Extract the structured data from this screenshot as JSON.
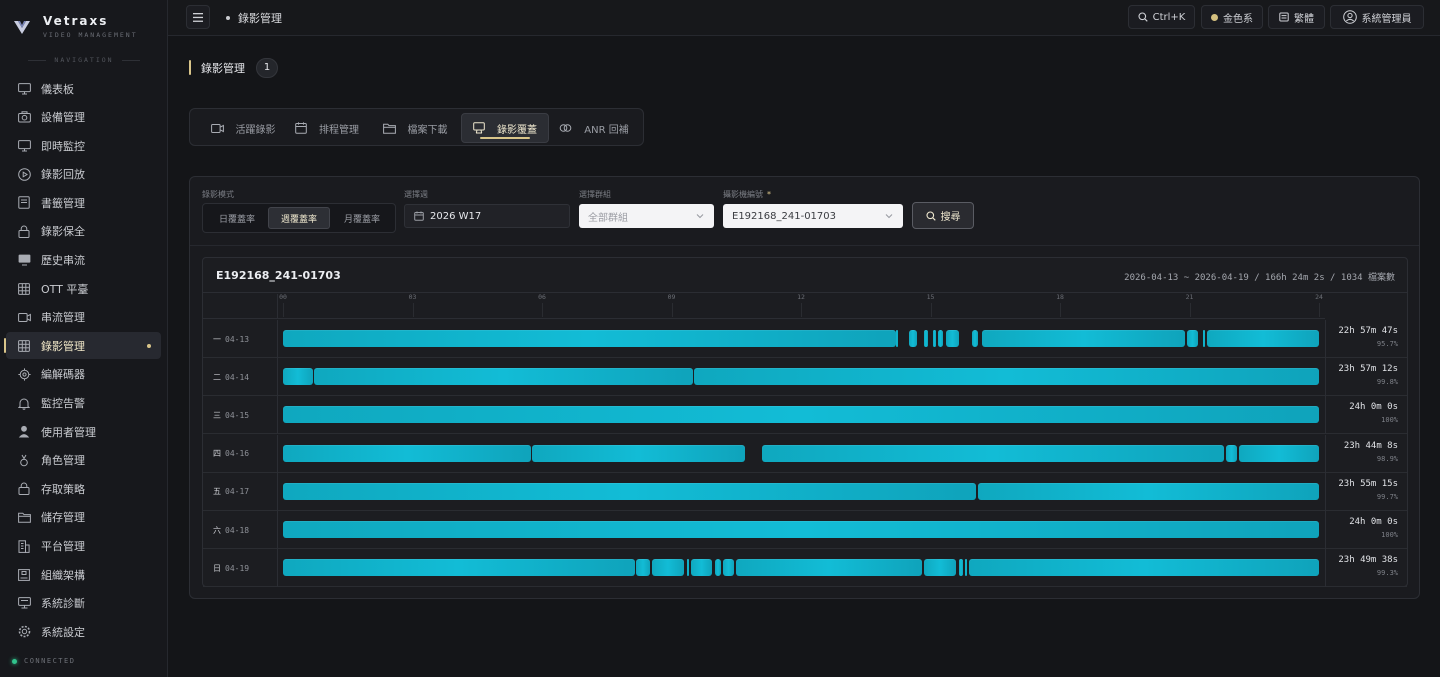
{
  "brand": {
    "name": "Vetraxs",
    "sub": "VIDEO MANAGEMENT"
  },
  "nav_heading": "NAVIGATION",
  "nav_items": [
    {
      "label": "儀表板",
      "icon": "monitor-icon"
    },
    {
      "label": "設備管理",
      "icon": "camera-icon"
    },
    {
      "label": "即時監控",
      "icon": "monitor-icon"
    },
    {
      "label": "錄影回放",
      "icon": "play-circle-icon"
    },
    {
      "label": "書籤管理",
      "icon": "bookmark-icon"
    },
    {
      "label": "錄影保全",
      "icon": "lock-icon"
    },
    {
      "label": "歷史串流",
      "icon": "screen-icon"
    },
    {
      "label": "OTT 平臺",
      "icon": "grid-icon"
    },
    {
      "label": "串流管理",
      "icon": "video-icon"
    },
    {
      "label": "錄影管理",
      "icon": "grid-icon",
      "active": true
    },
    {
      "label": "編解碼器",
      "icon": "chip-icon"
    },
    {
      "label": "監控告警",
      "icon": "bell-icon"
    },
    {
      "label": "使用者管理",
      "icon": "user-icon"
    },
    {
      "label": "角色管理",
      "icon": "role-icon"
    },
    {
      "label": "存取策略",
      "icon": "lock-icon"
    },
    {
      "label": "儲存管理",
      "icon": "folder-icon"
    },
    {
      "label": "平台管理",
      "icon": "building-icon"
    },
    {
      "label": "組織架構",
      "icon": "org-icon"
    },
    {
      "label": "系統診斷",
      "icon": "diagnose-icon"
    },
    {
      "label": "系統設定",
      "icon": "gear-icon"
    }
  ],
  "status": "CONNECTED",
  "topbar": {
    "breadcrumb": "錄影管理",
    "search_shortcut": "Ctrl+K",
    "theme": "金色系",
    "language": "繁體",
    "user": "系統管理員"
  },
  "page": {
    "title": "錄影管理",
    "count": "1"
  },
  "tabs": [
    {
      "label": "活躍錄影",
      "icon": "video-icon"
    },
    {
      "label": "排程管理",
      "icon": "calendar-icon"
    },
    {
      "label": "檔案下載",
      "icon": "folder-icon"
    },
    {
      "label": "錄影覆蓋",
      "icon": "coverage-icon",
      "active": true
    },
    {
      "label": "ANR 回補",
      "icon": "link-icon"
    }
  ],
  "filters": {
    "mode_label": "錄影模式",
    "modes": [
      "日覆蓋率",
      "週覆蓋率",
      "月覆蓋率"
    ],
    "mode_selected": "週覆蓋率",
    "week_label": "選擇週",
    "week_value": "2026 W17",
    "group_label": "選擇群組",
    "group_placeholder": "全部群組",
    "camera_label": "攝影機編號",
    "camera_required": "*",
    "camera_value": "E192168_241-01703",
    "search_label": "搜尋"
  },
  "timeline": {
    "camera": "E192168_241-01703",
    "summary": "2026-04-13 ~ 2026-04-19 / 166h 24m 2s / 1034 檔案數",
    "ticks": [
      "00",
      "03",
      "06",
      "09",
      "12",
      "15",
      "18",
      "21",
      "24"
    ],
    "rows": [
      {
        "weekday": "一",
        "date": "04-13",
        "duration": "22h 57m 47s",
        "pct": "95.7%",
        "segments": [
          [
            0,
            14.2
          ],
          [
            14.2,
            14.22
          ],
          [
            14.5,
            14.7
          ],
          [
            14.85,
            14.95
          ],
          [
            15.05,
            15.12
          ],
          [
            15.18,
            15.3
          ],
          [
            15.35,
            15.65
          ],
          [
            15.95,
            16.1
          ],
          [
            16.2,
            20.9
          ],
          [
            20.95,
            21.2
          ],
          [
            21.3,
            21.33
          ],
          [
            21.4,
            24
          ]
        ]
      },
      {
        "weekday": "二",
        "date": "04-14",
        "duration": "23h 57m 12s",
        "pct": "99.8%",
        "segments": [
          [
            0,
            0.7
          ],
          [
            0.72,
            9.5
          ],
          [
            9.52,
            24
          ]
        ]
      },
      {
        "weekday": "三",
        "date": "04-15",
        "duration": "24h 0m 0s",
        "pct": "100%",
        "segments": [
          [
            0,
            24
          ]
        ]
      },
      {
        "weekday": "四",
        "date": "04-16",
        "duration": "23h 44m 8s",
        "pct": "98.9%",
        "segments": [
          [
            0,
            5.75
          ],
          [
            5.77,
            10.7
          ],
          [
            11.1,
            21.8
          ],
          [
            21.85,
            22.1
          ],
          [
            22.15,
            24
          ]
        ]
      },
      {
        "weekday": "五",
        "date": "04-17",
        "duration": "23h 55m 15s",
        "pct": "99.7%",
        "segments": [
          [
            0,
            16.05
          ],
          [
            16.1,
            24
          ]
        ]
      },
      {
        "weekday": "六",
        "date": "04-18",
        "duration": "24h 0m 0s",
        "pct": "100%",
        "segments": [
          [
            0,
            24
          ]
        ]
      },
      {
        "weekday": "日",
        "date": "04-19",
        "duration": "23h 49m 38s",
        "pct": "99.3%",
        "segments": [
          [
            0,
            8.15
          ],
          [
            8.17,
            8.5
          ],
          [
            8.55,
            9.3
          ],
          [
            9.35,
            9.4
          ],
          [
            9.45,
            9.95
          ],
          [
            10.0,
            10.15
          ],
          [
            10.2,
            10.45
          ],
          [
            10.5,
            14.8
          ],
          [
            14.85,
            15.6
          ],
          [
            15.65,
            15.75
          ],
          [
            15.8,
            15.85
          ],
          [
            15.9,
            24
          ]
        ]
      }
    ]
  }
}
